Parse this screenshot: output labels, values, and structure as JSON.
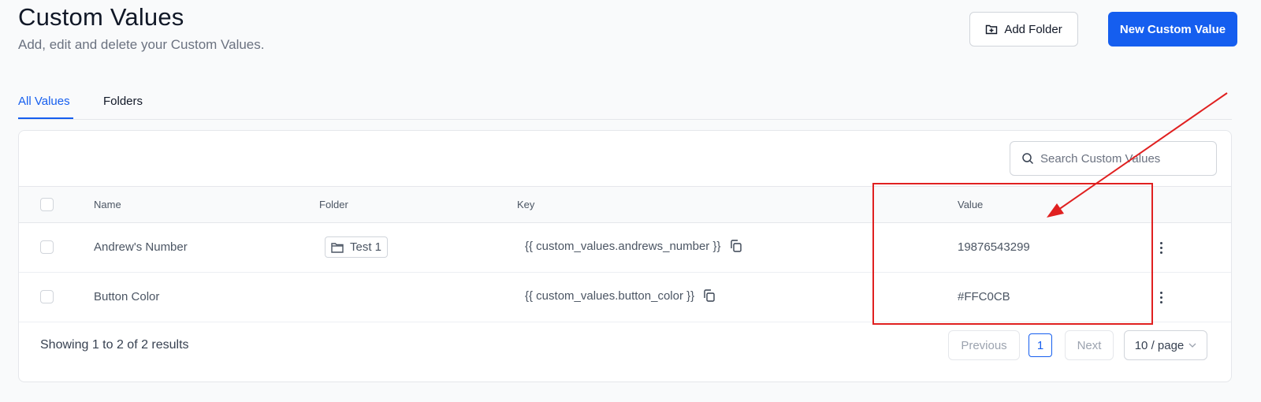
{
  "header": {
    "title": "Custom Values",
    "subtitle": "Add, edit and delete your Custom Values.",
    "add_folder_label": "Add Folder",
    "new_value_label": "New Custom Value"
  },
  "tabs": [
    {
      "label": "All Values",
      "active": true
    },
    {
      "label": "Folders",
      "active": false
    }
  ],
  "search": {
    "placeholder": "Search Custom Values",
    "value": ""
  },
  "table": {
    "columns": [
      "Name",
      "Folder",
      "Key",
      "Value"
    ],
    "rows": [
      {
        "name": "Andrew's Number",
        "folder": "Test 1",
        "key": "{{ custom_values.andrews_number }}",
        "value": "19876543299"
      },
      {
        "name": "Button Color",
        "folder": "",
        "key": "{{ custom_values.button_color }}",
        "value": "#FFC0CB"
      }
    ]
  },
  "footer": {
    "summary": "Showing 1 to 2 of 2 results",
    "previous_label": "Previous",
    "current_page": "1",
    "next_label": "Next",
    "page_size": "10 / page"
  },
  "colors": {
    "accent": "#155eef",
    "annotation": "#e02020"
  }
}
